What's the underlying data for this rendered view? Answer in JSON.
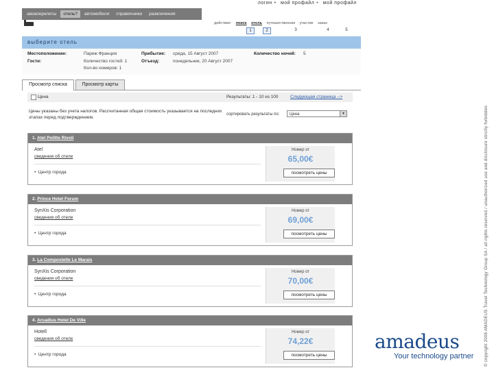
{
  "top_links": [
    "логин",
    "мой профайл",
    "мой профайл"
  ],
  "nav": {
    "tabs": [
      {
        "label": "авиаперелеты",
        "active": false
      },
      {
        "label": "отель?",
        "active": true
      },
      {
        "label": "автомобили",
        "active": false
      },
      {
        "label": "справочники",
        "active": false
      },
      {
        "label": "развлечения",
        "active": false
      }
    ]
  },
  "progress": {
    "steps": [
      "действие:",
      "поиск",
      "отель",
      "путешественник",
      "участие",
      "заказ"
    ],
    "numbers": [
      "1",
      "2",
      "3",
      "4",
      "5"
    ]
  },
  "page_title": "выберите отель",
  "search_info": {
    "location_label": "Местоположение:",
    "location_value": "Париж Франция",
    "guests_label": "Гости:",
    "guests_value_1": "Количество гостей: 1",
    "guests_value_2": "Кол-во номеров: 1",
    "arrival_label": "Прибытие:",
    "arrival_value": "среда, 15 Август 2007",
    "departure_label": "Отъезд:",
    "departure_value": "понедельник, 20 Август 2007",
    "nights_label": "Количество ночей:",
    "nights_value": "5"
  },
  "view_tabs": {
    "list": "Просмотр списка",
    "map": "Просмотр карты"
  },
  "results_header": {
    "left_label": "Цена",
    "count": "Результаты: 1 - 10 из 100",
    "next_link": "Следующая страница -->"
  },
  "price_note": "Цены указаны без учета налогов. Рассчитанная общая стоимость указывается на последних этапах перед подтверждением.",
  "sort": {
    "label": "сортировать результаты по:",
    "value": "Цена"
  },
  "hotels": [
    {
      "header": "1.",
      "name": "Atel Politte Rivoli",
      "chain": "Atel",
      "details_link": "сведения об отеле",
      "location": "Центр города",
      "from_label": "Номер от",
      "price": "65,00€",
      "button": "посмотреть цены"
    },
    {
      "header": "2.",
      "name": "Prince Hotel Forum",
      "chain": "SynXis Corporation",
      "details_link": "сведения об отеле",
      "location": "Центр города",
      "from_label": "Номер от",
      "price": "69,00€",
      "button": "посмотреть цены"
    },
    {
      "header": "3.",
      "name": "La Compostelle Le Marais",
      "chain": "SynXis Corporation",
      "details_link": "сведения об отеле",
      "location": "Центр города",
      "from_label": "Номер от",
      "price": "70,00€",
      "button": "посмотреть цены"
    },
    {
      "header": "4.",
      "name": "Arcadius Hotel De Ville",
      "chain": "Hotell",
      "details_link": "сведения об отеле",
      "location": "Центр города",
      "from_label": "Номер от",
      "price": "74,22€",
      "button": "посмотреть цены"
    }
  ],
  "copyright": "© copyright 2006 AMADEUS Travel Technology Group SA / all rights reserved / unauthorized use and disclosure strictly forbidden",
  "logo": {
    "word": "amadeus",
    "tagline": "Your technology partner"
  },
  "colors": {
    "brand": "#1a4a8a",
    "price": "#6fa0d6",
    "title_band": "#9fc4ea",
    "nav_bar": "#7a7a7a"
  }
}
